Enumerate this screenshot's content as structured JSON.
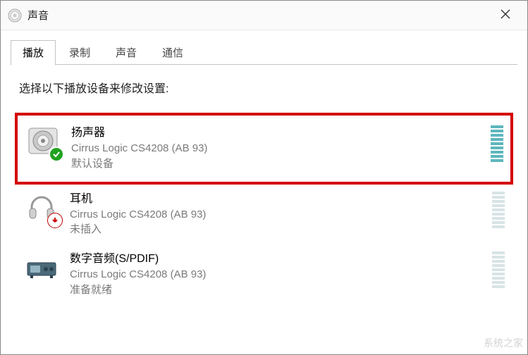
{
  "window": {
    "title": "声音"
  },
  "tabs": [
    {
      "label": "播放",
      "active": true
    },
    {
      "label": "录制",
      "active": false
    },
    {
      "label": "声音",
      "active": false
    },
    {
      "label": "通信",
      "active": false
    }
  ],
  "instruction": "选择以下播放设备来修改设置:",
  "devices": [
    {
      "name": "扬声器",
      "driver": "Cirrus Logic CS4208 (AB 93)",
      "status": "默认设备",
      "icon": "speaker",
      "badge": "check",
      "meter": "active",
      "highlighted": true
    },
    {
      "name": "耳机",
      "driver": "Cirrus Logic CS4208 (AB 93)",
      "status": "未插入",
      "icon": "headphones",
      "badge": "down",
      "meter": "dim",
      "highlighted": false
    },
    {
      "name": "数字音频(S/PDIF)",
      "driver": "Cirrus Logic CS4208 (AB 93)",
      "status": "准备就绪",
      "icon": "receiver",
      "badge": "none",
      "meter": "dim",
      "highlighted": false
    }
  ],
  "watermark": "系统之家"
}
